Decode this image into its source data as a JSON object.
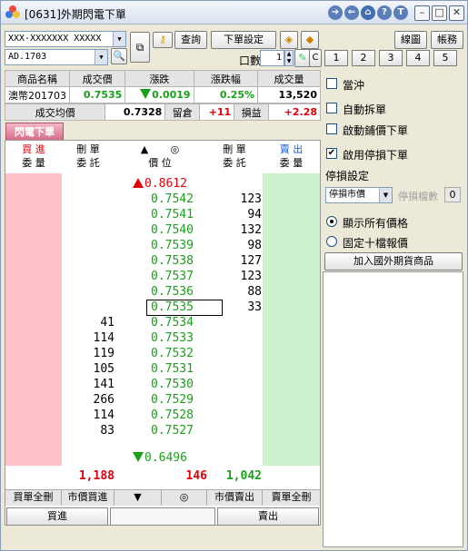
{
  "window": {
    "title": "[0631]外期閃電下單",
    "icons": [
      "app-logo-icon",
      "forward-icon",
      "back-icon",
      "link-icon",
      "help-icon",
      "topic-icon",
      "minimize-icon",
      "maximize-icon",
      "close-icon"
    ]
  },
  "toolbar": {
    "account_value": "XXX-XXXXXXX  XXXXX",
    "symbol_value": "AD.1703",
    "query_label": "查詢",
    "order_settings_label": "下單設定",
    "lots_label": "口數",
    "lots_value": "1",
    "c_label": "C",
    "chart_label": "線圖",
    "account_label": "帳務",
    "quick_lots": [
      "1",
      "2",
      "3",
      "4",
      "5"
    ]
  },
  "quote": {
    "headers": [
      "商品名稱",
      "成交價",
      "漲跌",
      "漲跌幅",
      "成交量"
    ],
    "name": "澳幣201703",
    "last": "0.7535",
    "change": "0.0019",
    "change_pct": "0.25%",
    "volume": "13,520",
    "avg_label": "成交均價",
    "avg_value": "0.7328",
    "position_label": "留倉",
    "position_value": "+11",
    "pnl_label": "損益",
    "pnl_value": "+2.28"
  },
  "tab": {
    "label": "閃電下單"
  },
  "ladder": {
    "headers": {
      "buy": "買 進",
      "buy_sub": "委 量",
      "cancel_l": "刪 單",
      "cancel_l_sub": "委 託",
      "up": "▲",
      "center": "◎",
      "price": "價 位",
      "cancel_r": "刪 單",
      "cancel_r_sub": "委 託",
      "sell": "賣 出",
      "sell_sub": "委 量"
    },
    "limit_up": "0.8612",
    "limit_down": "0.6496",
    "current_price": "0.7535",
    "rows": [
      {
        "price": "0.7542",
        "sell_orders": "123",
        "buy_orders": ""
      },
      {
        "price": "0.7541",
        "sell_orders": "94",
        "buy_orders": ""
      },
      {
        "price": "0.7540",
        "sell_orders": "132",
        "buy_orders": ""
      },
      {
        "price": "0.7539",
        "sell_orders": "98",
        "buy_orders": ""
      },
      {
        "price": "0.7538",
        "sell_orders": "127",
        "buy_orders": ""
      },
      {
        "price": "0.7537",
        "sell_orders": "123",
        "buy_orders": ""
      },
      {
        "price": "0.7536",
        "sell_orders": "88",
        "buy_orders": ""
      },
      {
        "price": "0.7535",
        "sell_orders": "33",
        "buy_orders": ""
      },
      {
        "price": "0.7534",
        "sell_orders": "",
        "buy_orders": "41"
      },
      {
        "price": "0.7533",
        "sell_orders": "",
        "buy_orders": "114"
      },
      {
        "price": "0.7532",
        "sell_orders": "",
        "buy_orders": "119"
      },
      {
        "price": "0.7531",
        "sell_orders": "",
        "buy_orders": "105"
      },
      {
        "price": "0.7530",
        "sell_orders": "",
        "buy_orders": "141"
      },
      {
        "price": "0.7529",
        "sell_orders": "",
        "buy_orders": "266"
      },
      {
        "price": "0.7528",
        "sell_orders": "",
        "buy_orders": "114"
      },
      {
        "price": "0.7527",
        "sell_orders": "",
        "buy_orders": "83"
      }
    ],
    "totals": {
      "buy_orders": "1,188",
      "center": "146",
      "sell_orders": "1,042"
    }
  },
  "bottom": {
    "cancel_all_buy": "買單全刪",
    "market_buy": "市價買進",
    "down": "▼",
    "center": "◎",
    "market_sell": "市價賣出",
    "cancel_all_sell": "賣單全刪",
    "buy": "買進",
    "sell": "賣出"
  },
  "options": {
    "hedge": "當沖",
    "auto_split": "自動拆單",
    "auto_buyback": "啟動鋪價下單",
    "stop_loss": "啟用停損下單",
    "stop_settings_label": "停損設定",
    "stop_type_value": "停損市價",
    "stop_ticks_label": "停損檔數",
    "stop_ticks_value": "0",
    "show_all_prices": "顯示所有價格",
    "fixed_ten": "固定十檔報價",
    "add_product": "加入國外期貨商品"
  },
  "colors": {
    "buy_bg": "#ffc0c8",
    "sell_bg": "#cdf0cd",
    "up": "#e0000a",
    "down": "#1a9f1a"
  }
}
